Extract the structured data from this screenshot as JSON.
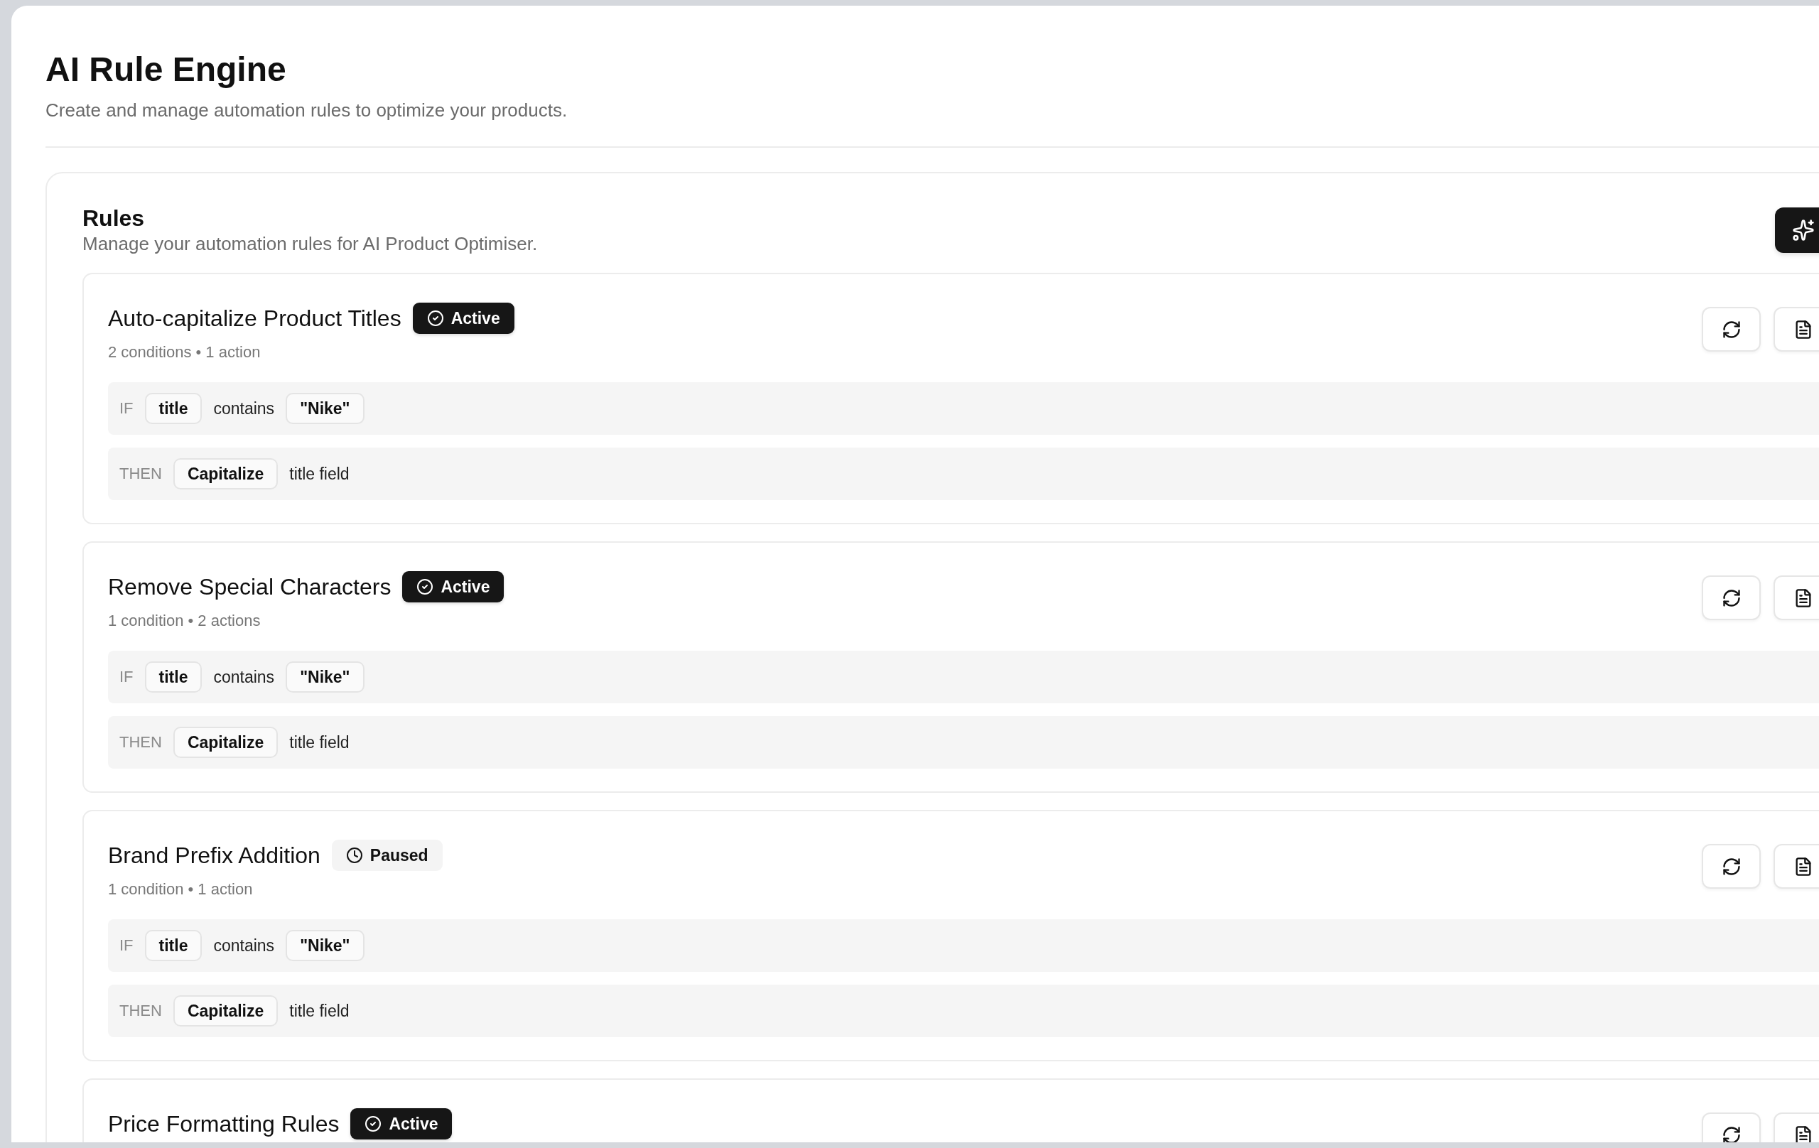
{
  "page": {
    "title": "AI Rule Engine",
    "subtitle": "Create and manage automation rules to optimize your products."
  },
  "rules_panel": {
    "title": "Rules",
    "subtitle": "Manage your automation rules for AI Product Optimiser."
  },
  "rules": [
    {
      "name": "Auto-capitalize Product Titles",
      "status": {
        "kind": "active",
        "label": "Active"
      },
      "summary": "2 conditions • 1 action",
      "condition": {
        "keyword": "IF",
        "field": "title",
        "operator": "contains",
        "value": "\"Nike\""
      },
      "action": {
        "keyword": "THEN",
        "verb": "Capitalize",
        "target": "title field"
      }
    },
    {
      "name": "Remove Special Characters",
      "status": {
        "kind": "active",
        "label": "Active"
      },
      "summary": "1 condition • 2 actions",
      "condition": {
        "keyword": "IF",
        "field": "title",
        "operator": "contains",
        "value": "\"Nike\""
      },
      "action": {
        "keyword": "THEN",
        "verb": "Capitalize",
        "target": "title field"
      }
    },
    {
      "name": "Brand Prefix Addition",
      "status": {
        "kind": "paused",
        "label": "Paused"
      },
      "summary": "1 condition • 1 action",
      "condition": {
        "keyword": "IF",
        "field": "title",
        "operator": "contains",
        "value": "\"Nike\""
      },
      "action": {
        "keyword": "THEN",
        "verb": "Capitalize",
        "target": "title field"
      }
    },
    {
      "name": "Price Formatting Rules",
      "status": {
        "kind": "active",
        "label": "Active"
      }
    }
  ]
}
